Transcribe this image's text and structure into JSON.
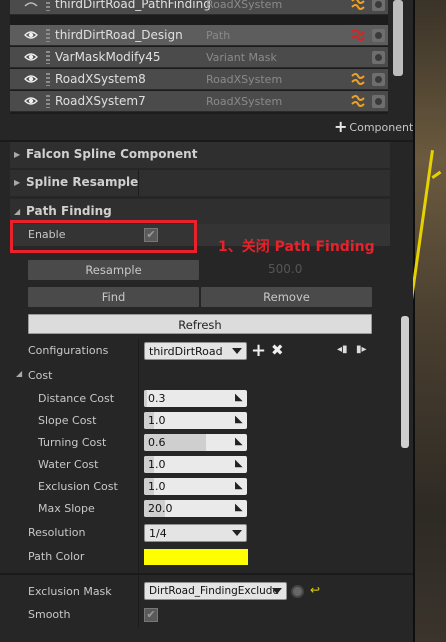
{
  "components": [
    {
      "name": "thirdDirtRoad_PathFinding",
      "type": "RoadXSystem",
      "icon": "road-icon",
      "selected": false
    },
    {
      "name": "thirdDirtRoad_Design",
      "type": "Path",
      "icon": "path-icon",
      "selected": true
    },
    {
      "name": "VarMaskModify45",
      "type": "Variant Mask",
      "icon": "none",
      "selected": false
    },
    {
      "name": "RoadXSystem8",
      "type": "RoadXSystem",
      "icon": "road-icon",
      "selected": false
    },
    {
      "name": "RoadXSystem7",
      "type": "RoadXSystem",
      "icon": "road-icon",
      "selected": false
    }
  ],
  "add_component": {
    "label": "Component"
  },
  "categories": {
    "falcon": "Falcon Spline Component",
    "resample": "Spline Resample",
    "pathfinding": "Path Finding",
    "cost": "Cost"
  },
  "enable": {
    "label": "Enable",
    "checked": true
  },
  "annotation": "1、关闭 Path Finding",
  "buttons": {
    "resample": "Resample",
    "resample_value": "500.0",
    "find": "Find",
    "remove": "Remove",
    "refresh": "Refresh"
  },
  "configurations": {
    "label": "Configurations",
    "value": "thirdDirtRoad"
  },
  "cost_fields": [
    {
      "label": "Distance Cost",
      "value": "0.3",
      "fill": 0.03
    },
    {
      "label": "Slope Cost",
      "value": "1.0",
      "fill": 0.1
    },
    {
      "label": "Turning Cost",
      "value": "0.6",
      "fill": 0.6
    },
    {
      "label": "Water Cost",
      "value": "1.0",
      "fill": 0.1
    },
    {
      "label": "Exclusion Cost",
      "value": "1.0",
      "fill": 0.1
    },
    {
      "label": "Max Slope",
      "value": "20.0",
      "fill": 0.2
    }
  ],
  "resolution": {
    "label": "Resolution",
    "value": "1/4"
  },
  "path_color": {
    "label": "Path Color",
    "color": "#ffff00"
  },
  "exclusion_mask": {
    "label": "Exclusion Mask",
    "value": "DirtRoad_FindingExclude"
  },
  "smooth": {
    "label": "Smooth",
    "checked": true
  },
  "colors": {
    "accent_red": "#e8212b",
    "road_icon": "#f0a020",
    "path_icon": "#e02020"
  }
}
